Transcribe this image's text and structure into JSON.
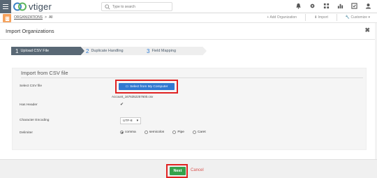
{
  "app": {
    "name": "vtiger"
  },
  "search": {
    "placeholder": "Type to search"
  },
  "breadcrumb": {
    "module": "ORGANIZATIONS",
    "separator": ">",
    "view": "All"
  },
  "actions": {
    "add": "+ Add Organization",
    "import": "Import",
    "customize": "Customize"
  },
  "modal": {
    "title": "Import Organizations",
    "close": "✖"
  },
  "steps": [
    {
      "num": "1",
      "label": "Upload CSV File"
    },
    {
      "num": "2",
      "label": "Duplicate Handling"
    },
    {
      "num": "3",
      "label": "Field Mapping"
    }
  ],
  "form": {
    "section_title": "Import from CSV file",
    "select_file_label": "Select CSV file",
    "select_button": "Select from My Computer",
    "file_name": "Account_1676352257600.csv",
    "has_header_label": "Has Header",
    "has_header_check": "✔",
    "encoding_label": "Character Encoding",
    "encoding_value": "UTF-8",
    "delimiter_label": "Delimiter",
    "delimiters": [
      "comma",
      "semicolon",
      "Pipe",
      "Caret"
    ]
  },
  "footer": {
    "next": "Next",
    "cancel": "Cancel"
  },
  "colors": {
    "accent_blue": "#3179d1",
    "next_green": "#35a14b",
    "highlight_red": "#e02222",
    "step_active": "#596875"
  }
}
